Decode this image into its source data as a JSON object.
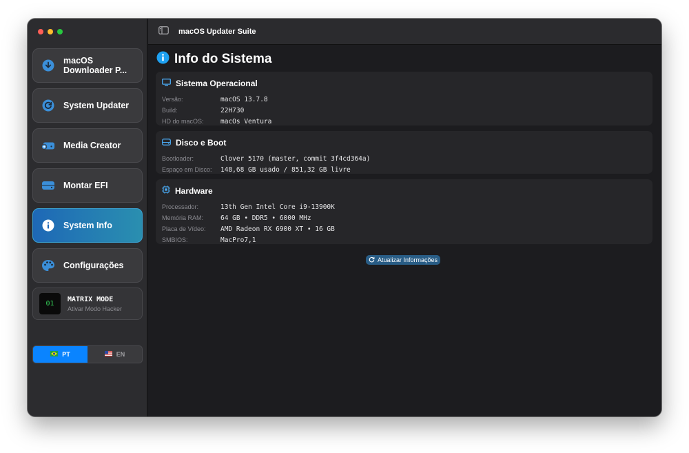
{
  "window": {
    "title": "macOS Updater Suite"
  },
  "sidebar": {
    "items": [
      {
        "label_line1": "macOS",
        "label_line2": "Downloader P...",
        "icon": "download-icon"
      },
      {
        "label": "System Updater",
        "icon": "update-icon"
      },
      {
        "label": "Media Creator",
        "icon": "drive-add-icon"
      },
      {
        "label": "Montar EFI",
        "icon": "drive-icon"
      },
      {
        "label": "System Info",
        "icon": "info-icon",
        "active": true
      },
      {
        "label": "Configurações",
        "icon": "palette-icon"
      }
    ],
    "matrix": {
      "badge": "01",
      "title": "MATRIX MODE",
      "subtitle": "Ativar Modo Hacker"
    },
    "language": {
      "pt": "PT",
      "en": "EN",
      "selected": "PT"
    }
  },
  "main": {
    "title": "Info do Sistema",
    "sections": {
      "os": {
        "title": "Sistema Operacional",
        "rows": [
          {
            "key": "Versão:",
            "value": "macOS 13.7.8"
          },
          {
            "key": "Build:",
            "value": "22H730"
          },
          {
            "key": "HD do macOS:",
            "value": "macOs Ventura"
          }
        ]
      },
      "disk": {
        "title": "Disco e Boot",
        "rows": [
          {
            "key": "Bootloader:",
            "value": "Clover 5170 (master, commit 3f4cd364a)"
          },
          {
            "key": "Espaço em Disco:",
            "value": "148,68 GB usado / 851,32 GB livre"
          }
        ]
      },
      "hardware": {
        "title": "Hardware",
        "rows": [
          {
            "key": "Processador:",
            "value": "13th Gen Intel Core i9-13900K"
          },
          {
            "key": "Memória RAM:",
            "value": "64 GB • DDR5 • 6000 MHz"
          },
          {
            "key": "Placa de Vídeo:",
            "value": "AMD Radeon RX 6900 XT • 16 GB"
          },
          {
            "key": "SMBIOS:",
            "value": "MacPro7,1"
          }
        ]
      }
    },
    "refresh_label": "Atualizar Informações"
  },
  "colors": {
    "accent": "#0a84ff",
    "info": "#1ea1f2",
    "active_gradient_start": "#1e68b6",
    "active_gradient_end": "#2a8fb0",
    "matrix_green": "#34d058"
  }
}
